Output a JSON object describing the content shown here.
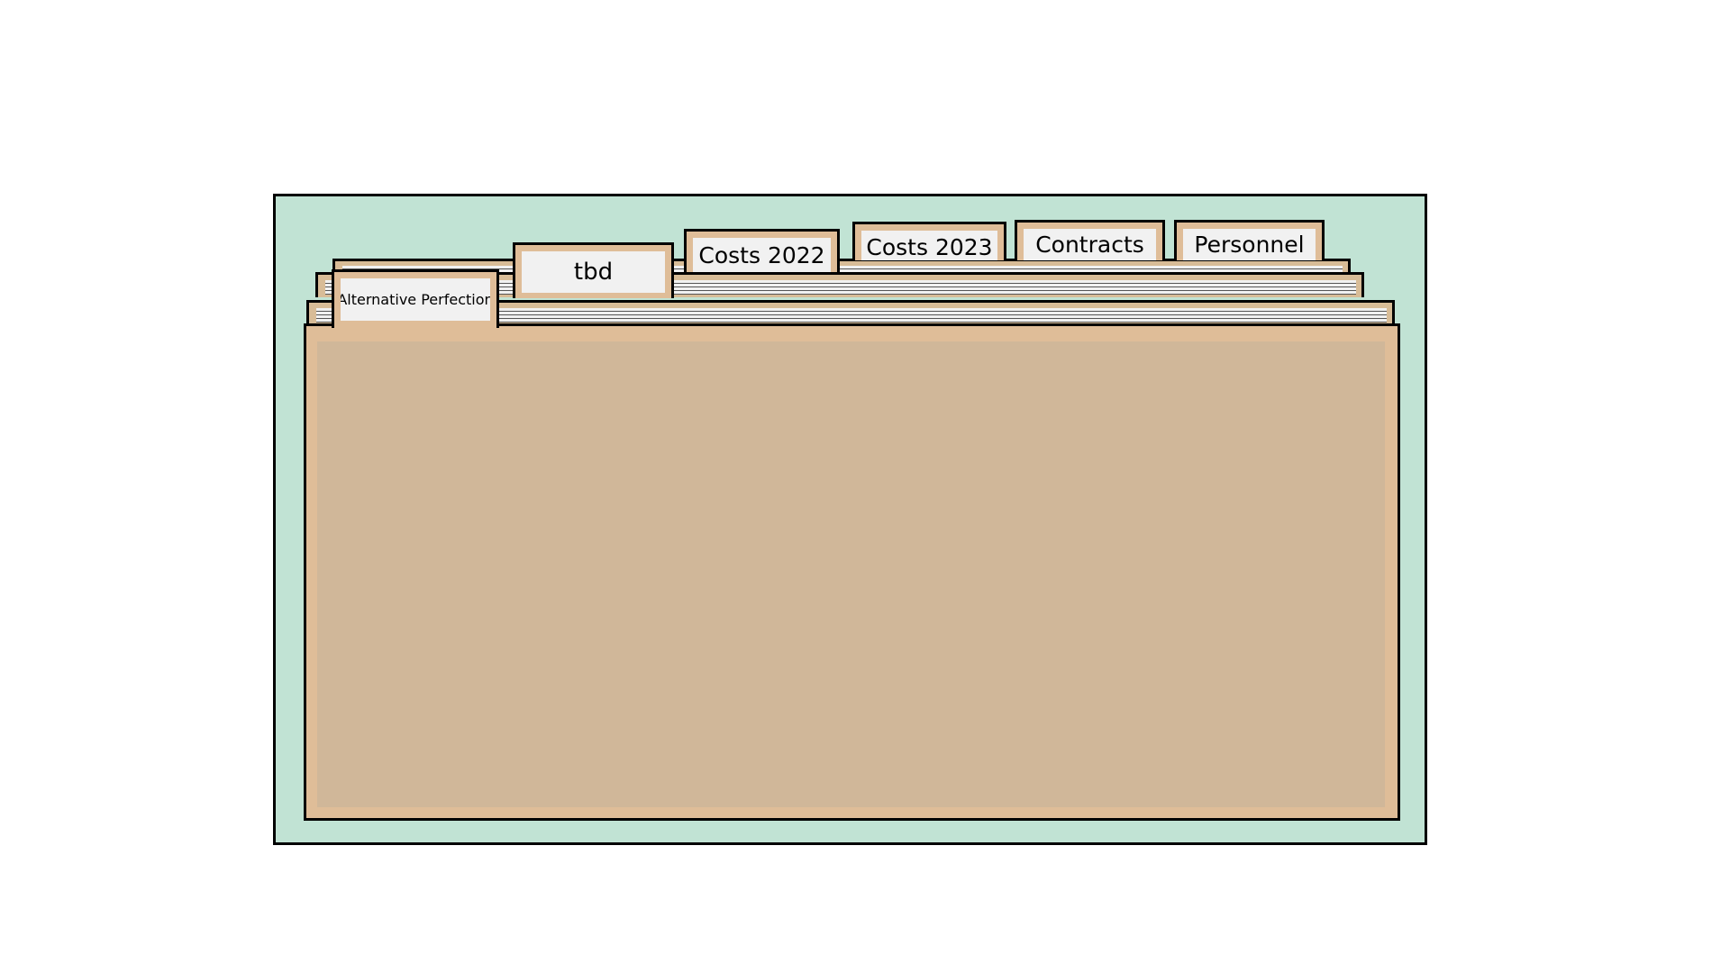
{
  "tabs": [
    {
      "label": "Alternative Perfection",
      "active": true
    },
    {
      "label": "tbd",
      "active": false
    },
    {
      "label": "Costs 2022",
      "active": false
    },
    {
      "label": "Costs 2023",
      "active": false
    },
    {
      "label": "Contracts",
      "active": false
    },
    {
      "label": "Personnel",
      "active": false
    }
  ],
  "colors": {
    "box_background": "#c1e3d4",
    "folder": "#dfbd98",
    "folder_inner": "#d0b799",
    "tab_label_background": "#f1f1f1",
    "outline": "#000000"
  }
}
